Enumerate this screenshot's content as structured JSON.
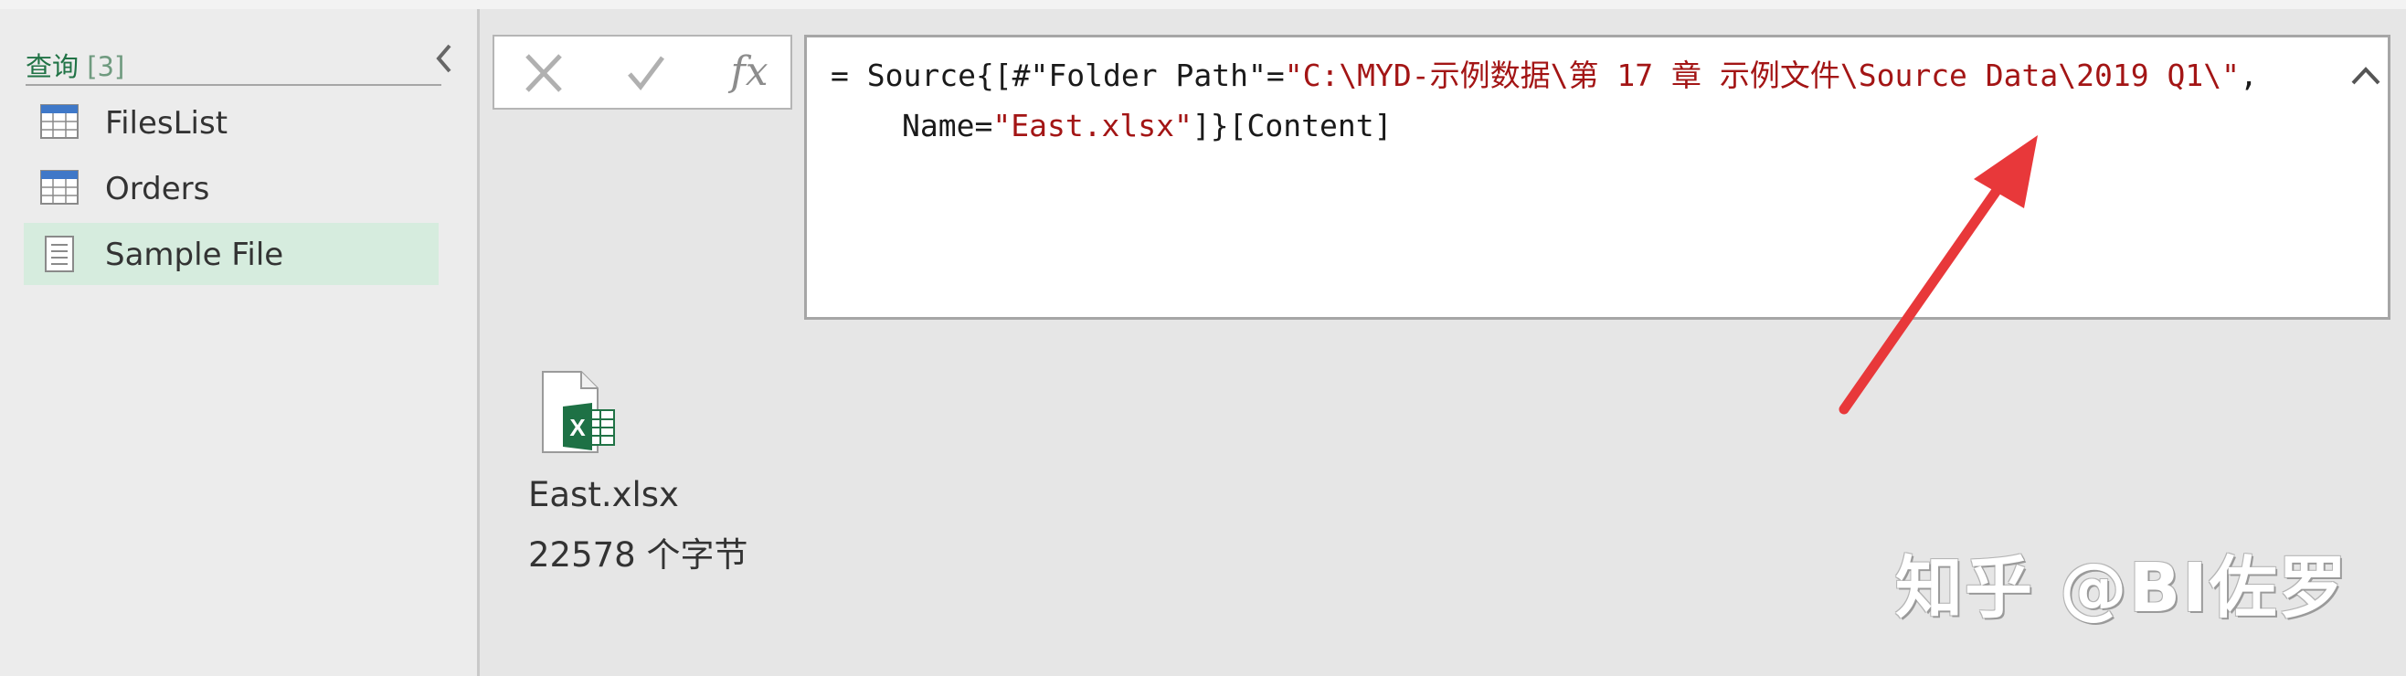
{
  "query_pane": {
    "title": "查询",
    "count": "[3]",
    "collapse_icon": "chevron-left-icon",
    "items": [
      {
        "label": "FilesList",
        "icon": "table-icon",
        "selected": false
      },
      {
        "label": "Orders",
        "icon": "table-icon",
        "selected": false
      },
      {
        "label": "Sample File",
        "icon": "document-icon",
        "selected": true
      }
    ]
  },
  "formula_bar": {
    "cancel_icon": "close-icon",
    "commit_icon": "checkmark-icon",
    "fx_label": "fx",
    "line1_prefix": "= Source{[#\"Folder Path\"=",
    "line1_string": "\"C:\\MYD-示例数据\\第 17 章 示例文件\\Source Data\\2019 Q1\\\"",
    "line1_suffix": ",",
    "line2_prefix": "Name=",
    "line2_string": "\"East.xlsx\"",
    "line2_suffix": "]}[Content]",
    "expand_icon": "chevron-up-icon",
    "string_color": "#a31515"
  },
  "preview": {
    "file_icon": "excel-file-icon",
    "file_name": "East.xlsx",
    "file_size": "22578 个字节"
  },
  "annotation": {
    "arrow_color": "#e8383a"
  },
  "watermark": {
    "text": "知乎 @BI佐罗"
  },
  "colors": {
    "accent": "#217346",
    "selected_bg": "#d6ecde"
  }
}
